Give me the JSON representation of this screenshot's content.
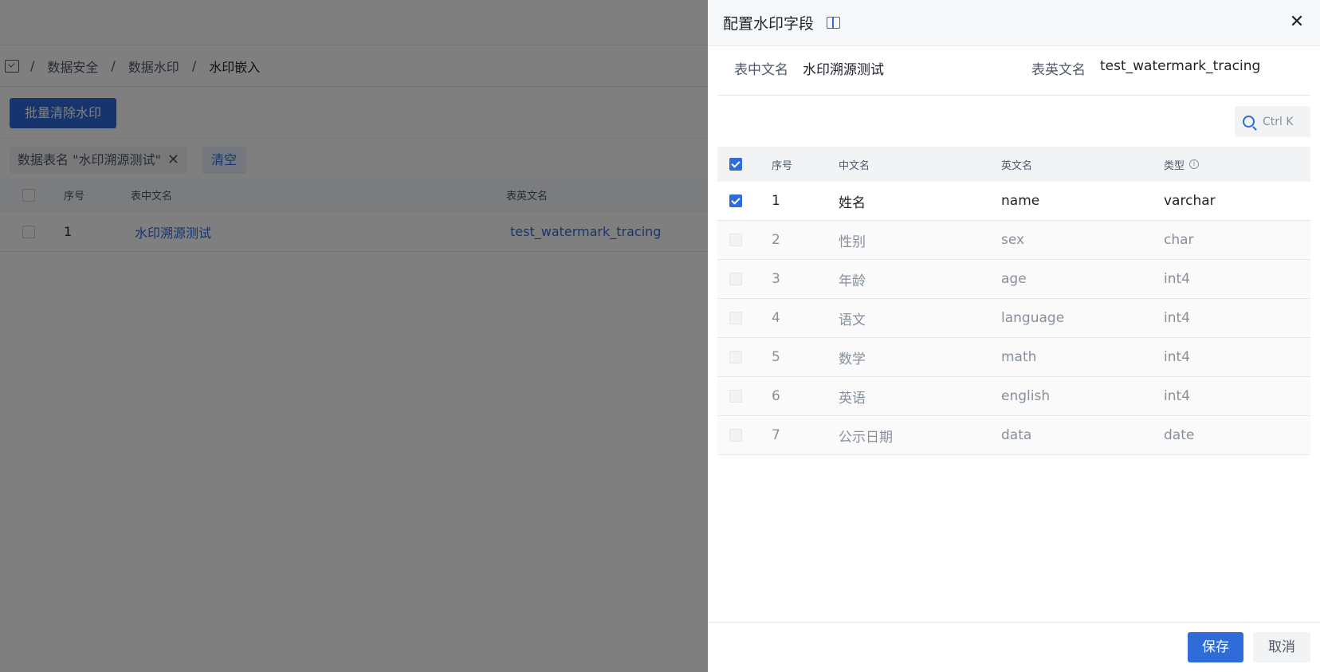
{
  "background": {
    "breadcrumb": [
      "数据安全",
      "数据水印",
      "水印嵌入"
    ],
    "batch_button": "批量清除水印",
    "filter_tag": "数据表名 \"水印溯源测试\"",
    "filter_tag_close": "✕",
    "clear_button": "清空",
    "table": {
      "headers": [
        "序号",
        "表中文名",
        "表英文名"
      ],
      "rows": [
        {
          "index": "1",
          "cn_name": "水印溯源测试",
          "en_name": "test_watermark_tracing"
        }
      ]
    }
  },
  "drawer": {
    "title": "配置水印字段",
    "close_glyph": "✕",
    "info": {
      "cn_label": "表中文名",
      "cn_value": "水印溯源测试",
      "en_label": "表英文名",
      "en_value": "test_watermark_tracing"
    },
    "search": {
      "placeholder": "Ctrl K"
    },
    "table": {
      "headers": {
        "index": "序号",
        "cn_name": "中文名",
        "en_name": "英文名",
        "type": "类型",
        "type_info_glyph": "i"
      },
      "rows": [
        {
          "index": "1",
          "cn_name": "姓名",
          "en_name": "name",
          "type": "varchar",
          "checked": true
        },
        {
          "index": "2",
          "cn_name": "性别",
          "en_name": "sex",
          "type": "char",
          "checked": false
        },
        {
          "index": "3",
          "cn_name": "年龄",
          "en_name": "age",
          "type": "int4",
          "checked": false
        },
        {
          "index": "4",
          "cn_name": "语文",
          "en_name": "language",
          "type": "int4",
          "checked": false
        },
        {
          "index": "5",
          "cn_name": "数学",
          "en_name": "math",
          "type": "int4",
          "checked": false
        },
        {
          "index": "6",
          "cn_name": "英语",
          "en_name": "english",
          "type": "int4",
          "checked": false
        },
        {
          "index": "7",
          "cn_name": "公示日期",
          "en_name": "data",
          "type": "date",
          "checked": false
        }
      ]
    },
    "footer": {
      "save": "保存",
      "cancel": "取消"
    }
  },
  "colors": {
    "primary": "#2f6bd9",
    "mask": "rgba(0,0,0,0.5)"
  }
}
